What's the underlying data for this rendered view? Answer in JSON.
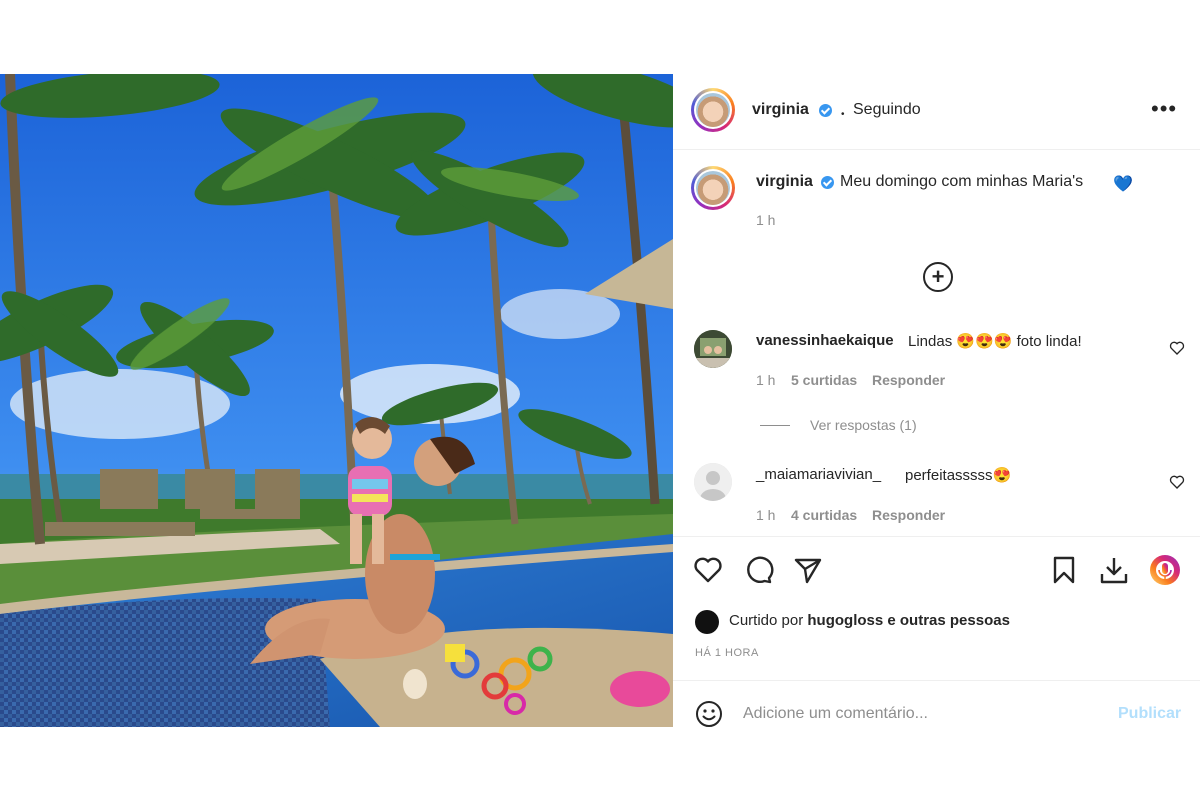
{
  "post": {
    "username": "virginia",
    "follow_status": "Seguindo",
    "more_options": "•••",
    "caption": "Meu domingo com minhas Maria's",
    "caption_emoji": "💙",
    "caption_time": "1 h"
  },
  "comments": [
    {
      "user": "vanessinhaekaique",
      "text_start": "Lindas",
      "emojis": "😍😍😍",
      "text_end": "foto linda!",
      "time": "1 h",
      "likes": "5 curtidas",
      "reply": "Responder"
    },
    {
      "user": "_maiamariavivian_",
      "text_start": "perfeitasssss",
      "emojis": "😍",
      "text_end": "",
      "time": "1 h",
      "likes": "4 curtidas",
      "reply": "Responder"
    }
  ],
  "view_replies": "Ver respostas (1)",
  "liked_by": {
    "prefix": "Curtido por",
    "user": "hugogloss",
    "suffix": "e outras pessoas"
  },
  "timestamp": "HÁ 1 HORA",
  "comment_box": {
    "placeholder": "Adicione um comentário...",
    "submit": "Publicar"
  },
  "colors": {
    "verified": "#3897f0",
    "publish_disabled": "#b2dffc",
    "muted": "#8e8e8e"
  }
}
